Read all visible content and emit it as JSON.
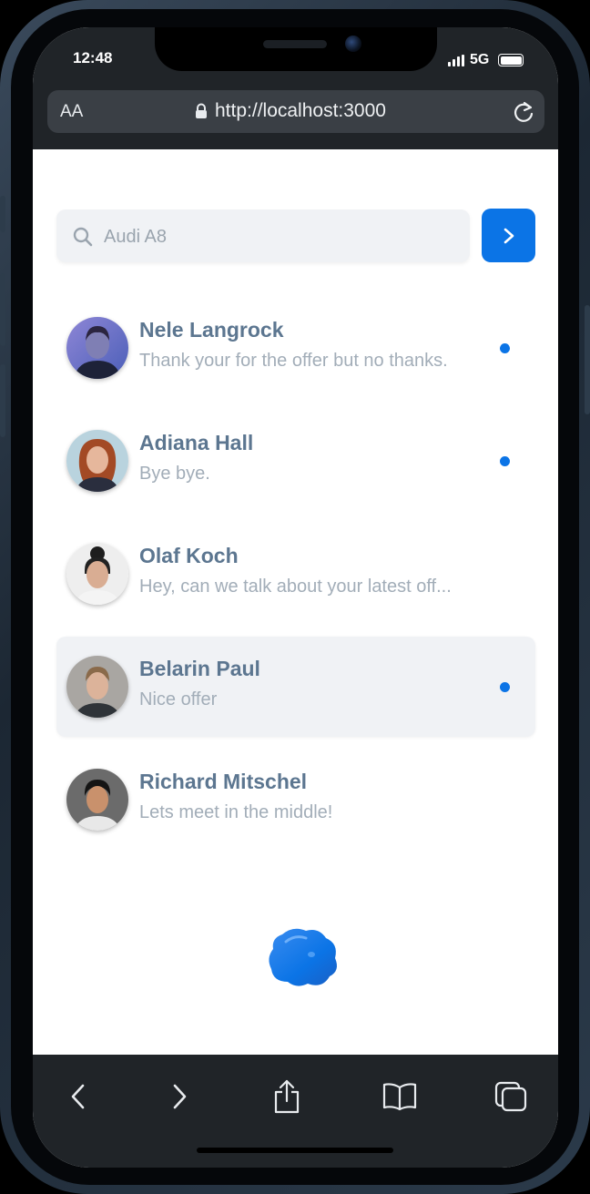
{
  "status": {
    "time": "12:48",
    "network": "5G"
  },
  "browser": {
    "text_size_label": "AA",
    "url": "http://localhost:3000"
  },
  "search": {
    "placeholder": "Audi A8"
  },
  "conversations": [
    {
      "name": "Nele Langrock",
      "last_message": "Thank your for the offer but no thanks.",
      "unread": true,
      "active": false
    },
    {
      "name": "Adiana Hall",
      "last_message": "Bye bye.",
      "unread": true,
      "active": false
    },
    {
      "name": "Olaf Koch",
      "last_message": "Hey, can we talk about your latest off...",
      "unread": false,
      "active": false
    },
    {
      "name": "Belarin Paul",
      "last_message": "Nice offer",
      "unread": true,
      "active": true
    },
    {
      "name": "Richard Mitschel",
      "last_message": "Lets meet in the middle!",
      "unread": false,
      "active": false
    }
  ],
  "colors": {
    "accent": "#0b74e6",
    "name_text": "#5c7690",
    "message_text": "#a2adb8",
    "chrome": "#202428"
  },
  "icons": {
    "lock": "lock-icon",
    "reload": "reload-icon",
    "search": "search-icon",
    "go": "chevron-right-icon",
    "back": "back-icon",
    "forward": "forward-icon",
    "share": "share-icon",
    "bookmarks": "bookmarks-icon",
    "tabs": "tabs-icon"
  }
}
